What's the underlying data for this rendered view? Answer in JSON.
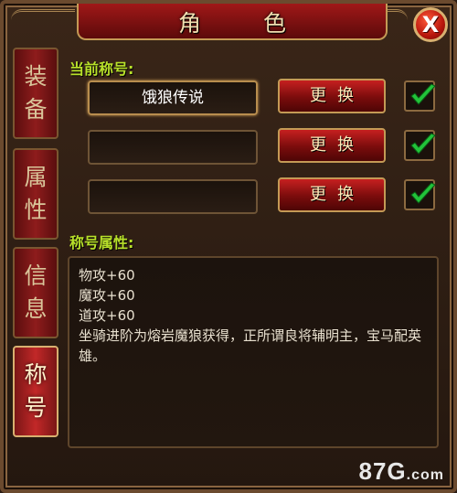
{
  "window": {
    "title": "角 色",
    "close_label": "X"
  },
  "sidebar": {
    "tabs": [
      {
        "label_1": "装",
        "label_2": "备",
        "active": false
      },
      {
        "label_1": "属",
        "label_2": "性",
        "active": false
      },
      {
        "label_1": "信",
        "label_2": "息",
        "active": false
      },
      {
        "label_1": "称",
        "label_2": "号",
        "active": true
      }
    ]
  },
  "current_title": {
    "label": "当前称号:",
    "slots": [
      {
        "value": "饿狼传说",
        "button": "更换",
        "checked": true
      },
      {
        "value": "",
        "button": "更换",
        "checked": true
      },
      {
        "value": "",
        "button": "更换",
        "checked": true
      }
    ]
  },
  "attributes": {
    "label": "称号属性:",
    "lines": [
      "物攻+60",
      "魔攻+60",
      "道攻+60"
    ],
    "description": "坐骑进阶为熔岩魔狼获得，正所谓良将辅明主，宝马配英雄。"
  },
  "watermark": {
    "main": "87G",
    "suffix": ".com"
  },
  "colors": {
    "accent_green": "#b8e02a",
    "tab_red": "#8e1c1c",
    "gold_border": "#c49a55"
  }
}
